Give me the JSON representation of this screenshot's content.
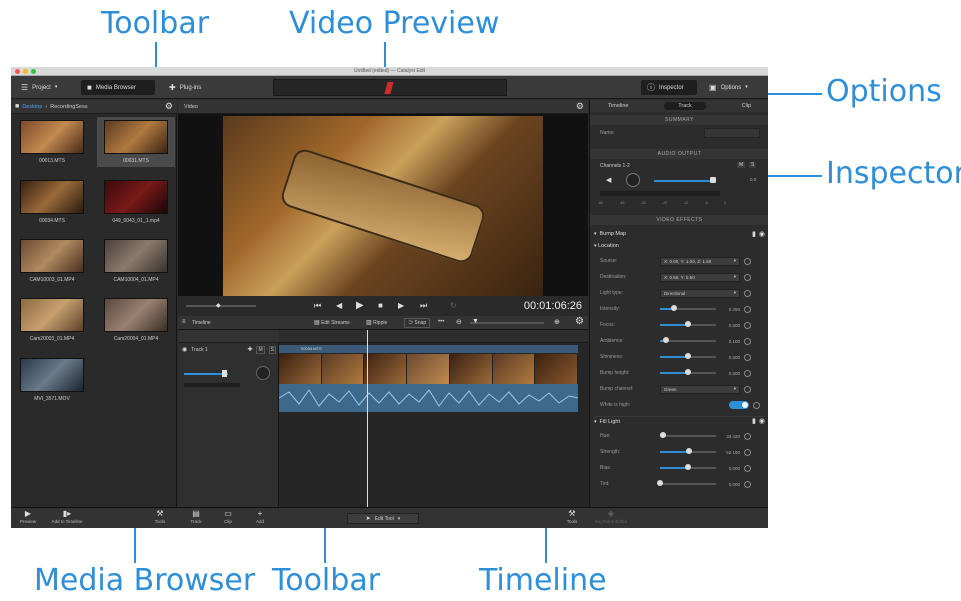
{
  "callouts": {
    "toolbar_top": "Toolbar",
    "video_preview": "Video Preview",
    "options": "Options",
    "inspector": "Inspector",
    "media_browser": "Media Browser",
    "toolbar_bottom": "Toolbar",
    "timeline": "Timeline"
  },
  "accent_color": "#2e8fd8",
  "window": {
    "title": "Untitled (edited) — Catalyst Edit"
  },
  "toolbar": {
    "project": "Project",
    "media_browser": "Media Browser",
    "plugins": "Plug-ins",
    "inspector": "Inspector",
    "options": "Options"
  },
  "browser": {
    "path_root": "Desktop",
    "path_leaf": "RecordingSess",
    "clips": [
      "00013.MTS",
      "00031.MTS",
      "00034.MTS",
      "049_0043_01_1.mp4",
      "CAM10003_01.MP4",
      "CAM10004_01.MP4",
      "Cam20003_01.MP4",
      "Cam20004_01.MP4",
      "MVI_3571.MOV"
    ]
  },
  "preview": {
    "label": "Video",
    "timecode": "00:01:06:26"
  },
  "timeline": {
    "label": "Timeline",
    "edit_streams": "Edit Streams",
    "ripple": "Ripple",
    "snap": "Snap",
    "track_name": "Track 1",
    "m": "M",
    "s": "S",
    "clip_name": "00034.MTS"
  },
  "inspector": {
    "tabs": [
      "Timeline",
      "Track",
      "Clip"
    ],
    "summary": "SUMMARY",
    "name_label": "Name:",
    "audio_output": "AUDIO OUTPUT",
    "channels": "Channels 1-2",
    "m": "M",
    "s": "S",
    "audio_value": "0.0",
    "meter_ticks": [
      "-60",
      "-45",
      "-30",
      "-20",
      "-12",
      "-6",
      "0"
    ],
    "video_effects": "VIDEO EFFECTS",
    "bump_map": "Bump Map",
    "location": "Location",
    "source_label": "Source:",
    "source_value": "X: 0.00, Y: 1.00, Z: 1.50",
    "destination_label": "Destination:",
    "destination_value": "X: 0.50, Y: 0.50",
    "light_type_label": "Light type:",
    "light_type_value": "Directional",
    "params": [
      {
        "label": "Intensity:",
        "value": "0.250",
        "level": 0.25
      },
      {
        "label": "Focus:",
        "value": "0.500",
        "level": 0.5
      },
      {
        "label": "Ambience:",
        "value": "0.100",
        "level": 0.1
      },
      {
        "label": "Shininess:",
        "value": "0.500",
        "level": 0.5
      },
      {
        "label": "Bump height:",
        "value": "0.500",
        "level": 0.5
      }
    ],
    "bump_channel_label": "Bump channel:",
    "bump_channel_value": "Green",
    "white_is_high": "White is high:",
    "fill_light": "Fill Light",
    "fill_params": [
      {
        "label": "Hue:",
        "value": "33.420",
        "level": 0.05
      },
      {
        "label": "Strength:",
        "value": "52.190",
        "level": 0.52
      },
      {
        "label": "Bias:",
        "value": "0.000",
        "level": 0.5
      },
      {
        "label": "Tint:",
        "value": "0.000",
        "level": 0.0
      }
    ]
  },
  "bottom": {
    "preview": "Preview",
    "add_to_timeline": "Add to Timeline",
    "tools": "Tools",
    "track": "Track",
    "clip": "Clip",
    "add": "Add",
    "edit_tool": "Edit Tool",
    "tools_right": "Tools",
    "keyframe_editor": "Keyframe Editor"
  }
}
